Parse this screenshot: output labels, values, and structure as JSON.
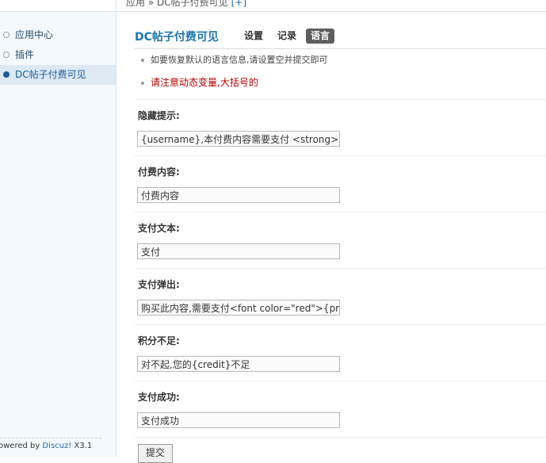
{
  "breadcrumb": {
    "text": "应用 » DC帖子付费可见",
    "add": "[+]"
  },
  "sidebar": {
    "items": [
      {
        "label": "应用中心"
      },
      {
        "label": "插件"
      },
      {
        "label": "DC帖子付费可见",
        "active": true
      }
    ],
    "powered_prefix": "owered by",
    "powered_brand": "Discuz!",
    "powered_version": "X3.1"
  },
  "plugin": {
    "title": "DC帖子付费可见",
    "tabs": [
      {
        "label": "设置"
      },
      {
        "label": "记录"
      },
      {
        "label": "语言",
        "active": true
      }
    ]
  },
  "notes": [
    "如要恢复默认的语言信息,请设置空并提交即可",
    "请注意动态变量,大括号的"
  ],
  "fields": [
    {
      "label": "隐藏提示:",
      "value": "{username},本付费内容需要支付 <strong>"
    },
    {
      "label": "付费内容:",
      "value": "付费内容"
    },
    {
      "label": "支付文本:",
      "value": "支付"
    },
    {
      "label": "支付弹出:",
      "value": "购买此内容,需要支付<font color=\"red\">{pr"
    },
    {
      "label": "积分不足:",
      "value": "对不起,您的{credit}不足"
    },
    {
      "label": "支付成功:",
      "value": "支付成功"
    }
  ],
  "submit_label": "提交"
}
